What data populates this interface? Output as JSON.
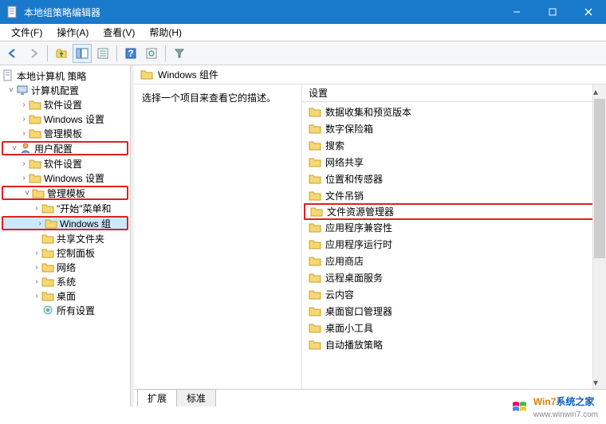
{
  "window": {
    "title": "本地组策略编辑器"
  },
  "menu": {
    "file": "文件(F)",
    "action": "操作(A)",
    "view": "查看(V)",
    "help": "帮助(H)"
  },
  "tree": {
    "root": "本地计算机 策略",
    "computer_config": "计算机配置",
    "cc_software": "软件设置",
    "cc_windows": "Windows 设置",
    "cc_admin": "管理模板",
    "user_config": "用户配置",
    "uc_software": "软件设置",
    "uc_windows": "Windows 设置",
    "uc_admin": "管理模板",
    "start_menu": "\"开始\"菜单和",
    "windows_comp": "Windows 组",
    "shared_folders": "共享文件夹",
    "control_panel": "控制面板",
    "network": "网络",
    "system": "系统",
    "desktop": "桌面",
    "all_settings": "所有设置"
  },
  "content": {
    "title": "Windows 组件",
    "description": "选择一个项目来查看它的描述。",
    "list_header": "设置",
    "items": [
      "数据收集和预览版本",
      "数字保险箱",
      "搜索",
      "网络共享",
      "位置和传感器",
      "文件吊销",
      "文件资源管理器",
      "应用程序兼容性",
      "应用程序运行时",
      "应用商店",
      "远程桌面服务",
      "云内容",
      "桌面窗口管理器",
      "桌面小工具",
      "自动播放策略"
    ],
    "highlighted_index": 6
  },
  "tabs": {
    "extended": "扩展",
    "standard": "标准"
  },
  "watermark": {
    "brand1": "Win7",
    "brand2": "系统之家",
    "url": "www.winwin7.com"
  }
}
